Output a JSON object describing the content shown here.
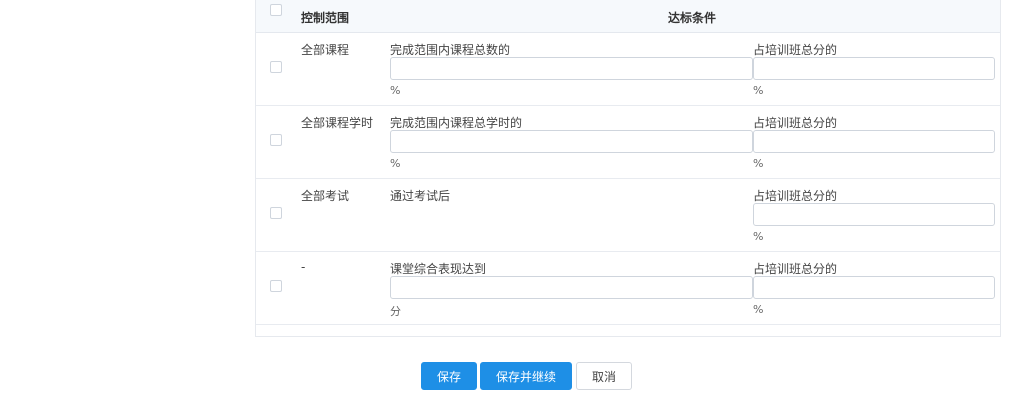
{
  "table": {
    "headers": {
      "scope": "控制范围",
      "condition": "达标条件"
    },
    "rows": [
      {
        "scope": "全部课程",
        "condition_label": "完成范围内课程总数的",
        "condition_input": "",
        "condition_unit": "%",
        "score_label": "占培训班总分的",
        "score_input": "",
        "score_unit": "%"
      },
      {
        "scope": "全部课程学时",
        "condition_label": "完成范围内课程总学时的",
        "condition_input": "",
        "condition_unit": "%",
        "score_label": "占培训班总分的",
        "score_input": "",
        "score_unit": "%"
      },
      {
        "scope": "全部考试",
        "condition_label": "通过考试后",
        "score_label": "占培训班总分的",
        "score_input": "",
        "score_unit": "%"
      },
      {
        "scope": "-",
        "condition_label": "课堂综合表现达到",
        "condition_input": "",
        "condition_unit": "分",
        "score_label": "占培训班总分的",
        "score_input": "",
        "score_unit": "%"
      }
    ]
  },
  "actions": {
    "save": "保存",
    "save_continue": "保存并继续",
    "cancel": "取消"
  },
  "colors": {
    "primary": "#1e8fe6",
    "border": "#cfd5dd",
    "header_bg": "#f6f9fc"
  }
}
